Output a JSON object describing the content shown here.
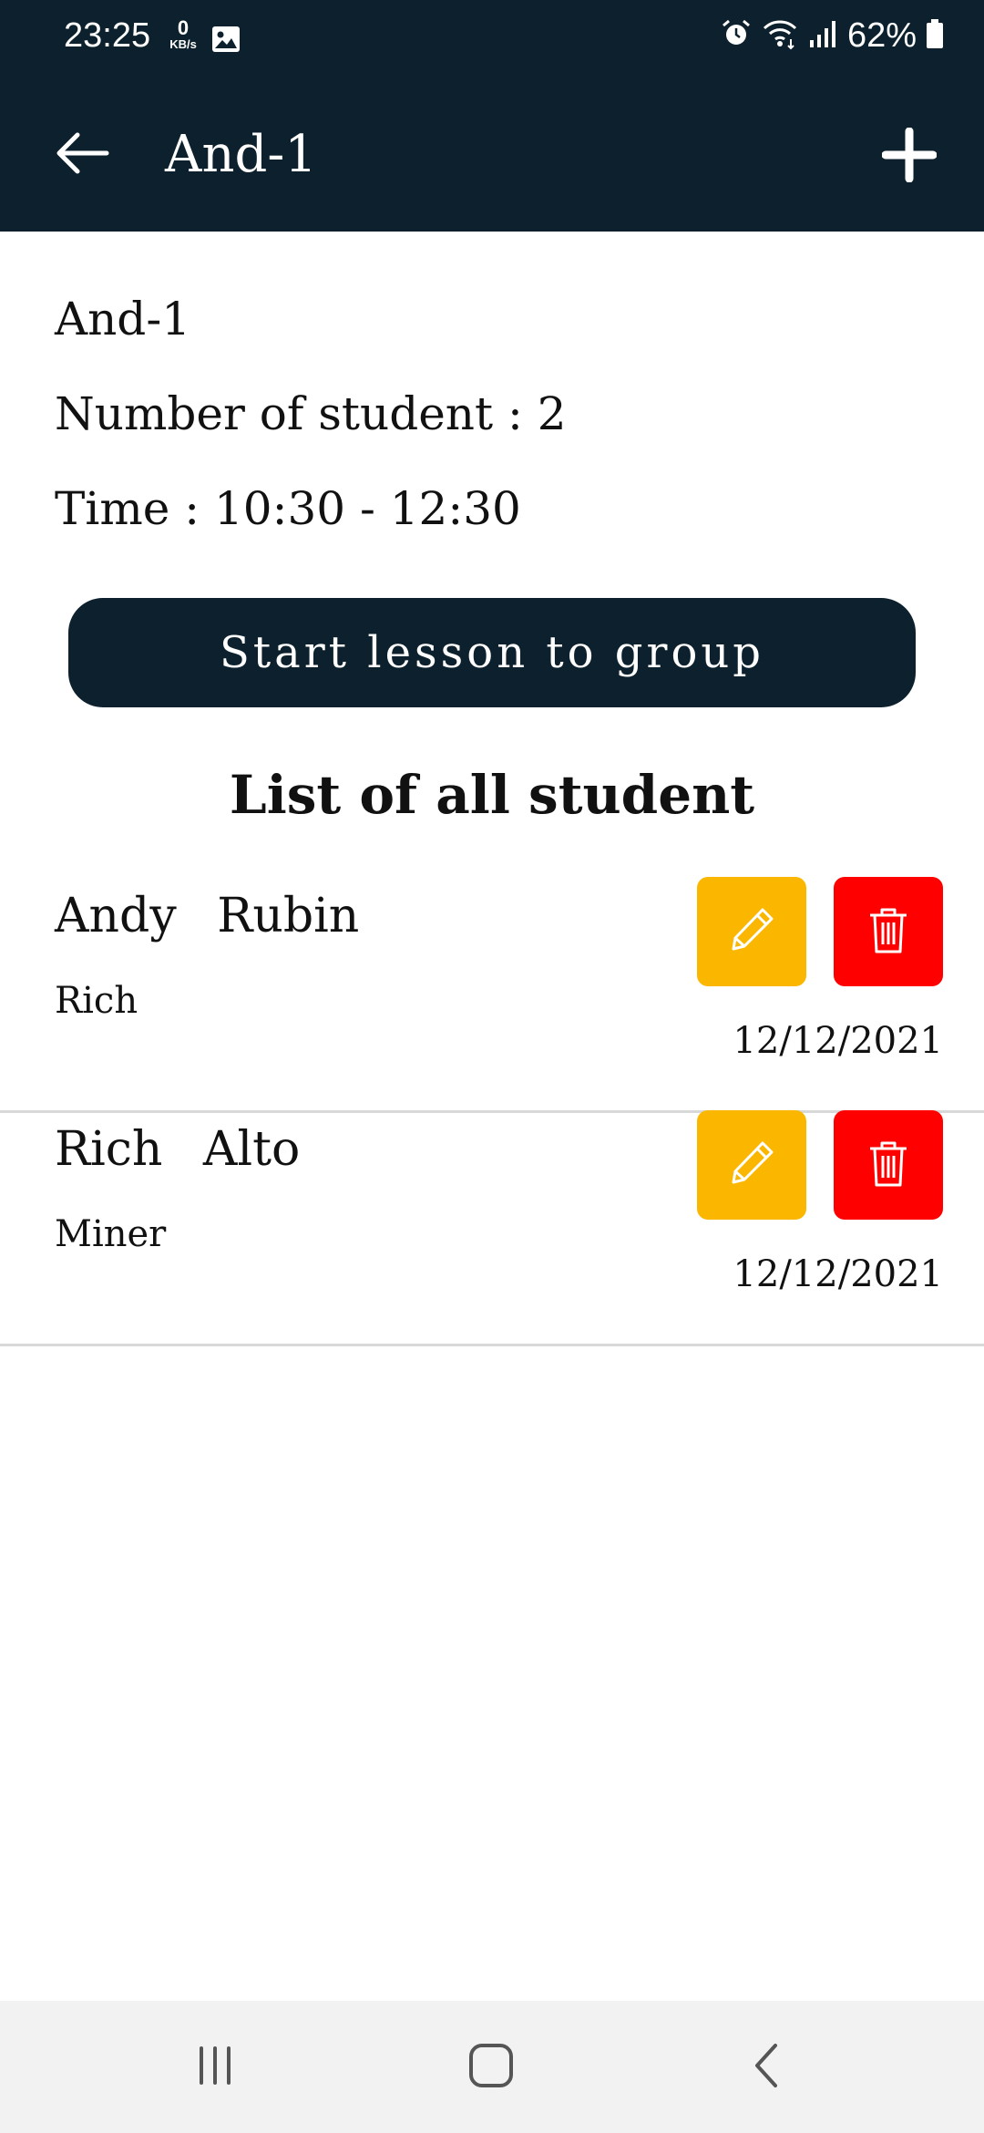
{
  "status_bar": {
    "time": "23:25",
    "net_speed_value": "0",
    "net_speed_unit": "KB/s",
    "battery": "62%",
    "icons": [
      "gallery-icon",
      "alarm-icon",
      "wifi-icon",
      "signal-icon",
      "battery-icon"
    ]
  },
  "app_bar": {
    "title": "And-1",
    "icons": [
      "back-arrow-icon",
      "plus-icon"
    ]
  },
  "group": {
    "name": "And-1",
    "students_line": "Number of student : 2",
    "time_line": "Time : 10:30 - 12:30"
  },
  "start_button": {
    "label": "Start lesson to group"
  },
  "list": {
    "title": "List of all student",
    "students": [
      {
        "name": "Andy Rubin",
        "sub": "Rich",
        "date": "12/12/2021"
      },
      {
        "name": "Rich Alto",
        "sub": "Miner",
        "date": "12/12/2021"
      }
    ]
  },
  "colors": {
    "app_bar": "#0c212d",
    "edit": "#fbb700",
    "delete": "#ff0000",
    "nav_bar": "#f2f2f2"
  },
  "nav_bar": {
    "icons": [
      "recents-icon",
      "home-icon",
      "back-icon"
    ]
  }
}
